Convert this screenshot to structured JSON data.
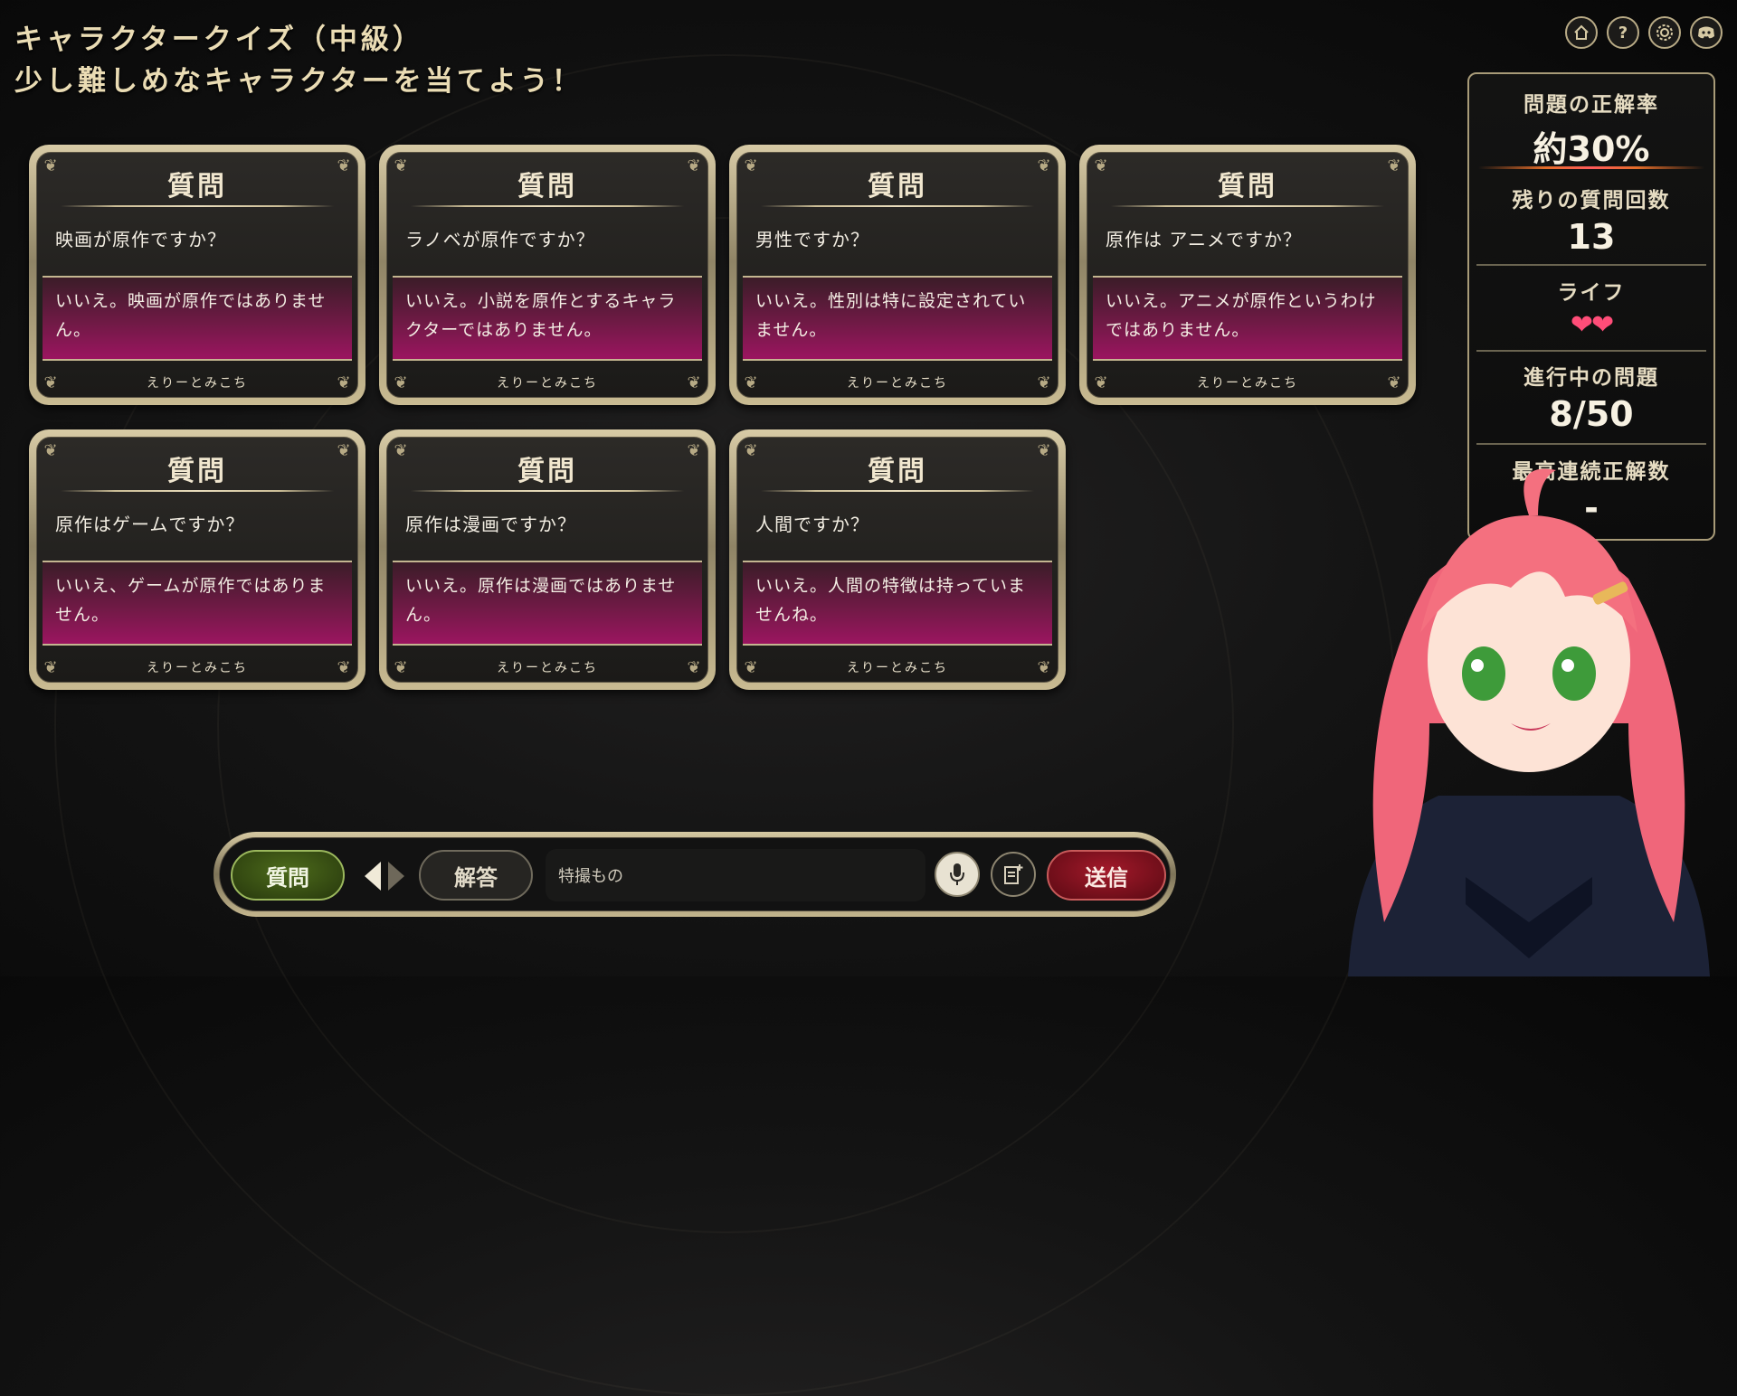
{
  "header": {
    "title": "キャラクタークイズ（中級）",
    "subtitle": "少し難しめなキャラクターを当てよう！"
  },
  "top_icons": [
    "home-icon",
    "help-icon",
    "gear-icon",
    "discord-icon"
  ],
  "cards": [
    {
      "title": "質問",
      "question": "映画が原作ですか？",
      "answer": "いいえ。映画が原作ではありません。",
      "footer": "えりーとみこち"
    },
    {
      "title": "質問",
      "question": "ラノベが原作ですか？",
      "answer": "いいえ。小説を原作とするキャラクターではありません。",
      "footer": "えりーとみこち"
    },
    {
      "title": "質問",
      "question": "男性ですか？",
      "answer": "いいえ。性別は特に設定されていません。",
      "footer": "えりーとみこち"
    },
    {
      "title": "質問",
      "question": "原作は アニメですか？",
      "answer": "いいえ。アニメが原作というわけではありません。",
      "footer": "えりーとみこち"
    },
    {
      "title": "質問",
      "question": "原作はゲームですか？",
      "answer": "いいえ、ゲームが原作ではありません。",
      "footer": "えりーとみこち"
    },
    {
      "title": "質問",
      "question": "原作は漫画ですか？",
      "answer": "いいえ。原作は漫画ではありません。",
      "footer": "えりーとみこち"
    },
    {
      "title": "質問",
      "question": "人間ですか？",
      "answer": "いいえ。人間の特徴は持っていませんね。",
      "footer": "えりーとみこち"
    }
  ],
  "stats": {
    "accuracy_label": "問題の正解率",
    "accuracy_value": "約30%",
    "remaining_label": "残りの質問回数",
    "remaining_value": "13",
    "life_label": "ライフ",
    "life_count": 2,
    "life_hearts": "❤❤",
    "progress_label": "進行中の問題",
    "progress_value": "8/50",
    "streak_label": "最高連続正解数",
    "streak_value": "-"
  },
  "input_bar": {
    "question_button": "質問",
    "answer_button": "解答",
    "input_value": "特撮もの",
    "send_button": "送信"
  },
  "colors": {
    "accent_pink": "#9b1560",
    "gold": "#cbbd96",
    "question_green": "#4d6b1b",
    "send_red": "#a3192a"
  }
}
